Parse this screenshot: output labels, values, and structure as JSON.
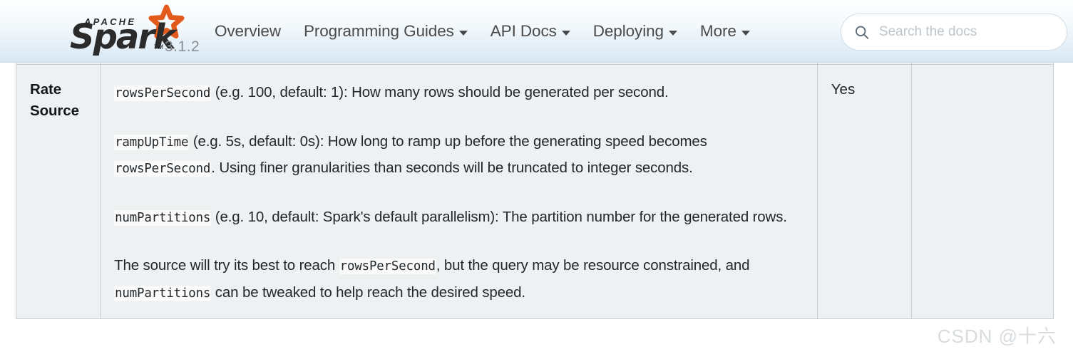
{
  "navbar": {
    "brand": {
      "apache_text": "APACHE",
      "spark_text": "Spark",
      "tm": "TM",
      "version": "3.1.2",
      "star_color": "#e25a1c",
      "wordmark_color": "#2b2b2b",
      "version_color": "#8a8f94"
    },
    "items": [
      {
        "label": "Overview",
        "has_dropdown": false
      },
      {
        "label": "Programming Guides",
        "has_dropdown": true
      },
      {
        "label": "API Docs",
        "has_dropdown": true
      },
      {
        "label": "Deploying",
        "has_dropdown": true
      },
      {
        "label": "More",
        "has_dropdown": true
      }
    ],
    "search": {
      "placeholder": "Search the docs",
      "value": "",
      "icon": "search-icon"
    }
  },
  "table": {
    "row": {
      "source_name": "Rate Source",
      "fault_tolerant": "Yes",
      "notes": "",
      "description": [
        {
          "parts": [
            {
              "type": "code",
              "text": "rowsPerSecond"
            },
            {
              "type": "text",
              "text": " (e.g. 100, default: 1): How many rows should be generated per second."
            }
          ]
        },
        {
          "parts": [
            {
              "type": "code",
              "text": "rampUpTime"
            },
            {
              "type": "text",
              "text": " (e.g. 5s, default: 0s): How long to ramp up before the generating speed becomes "
            },
            {
              "type": "code",
              "text": "rowsPerSecond"
            },
            {
              "type": "text",
              "text": ". Using finer granularities than seconds will be truncated to integer seconds."
            }
          ]
        },
        {
          "parts": [
            {
              "type": "code",
              "text": "numPartitions"
            },
            {
              "type": "text",
              "text": " (e.g. 10, default: Spark's default parallelism): The partition number for the generated rows."
            }
          ]
        },
        {
          "parts": [
            {
              "type": "text",
              "text": "The source will try its best to reach "
            },
            {
              "type": "code",
              "text": "rowsPerSecond"
            },
            {
              "type": "text",
              "text": ", but the query may be resource constrained, and "
            },
            {
              "type": "code",
              "text": "numPartitions"
            },
            {
              "type": "text",
              "text": " can be tweaked to help reach the desired speed."
            }
          ]
        }
      ]
    }
  },
  "watermark": {
    "text": "CSDN @十六"
  }
}
